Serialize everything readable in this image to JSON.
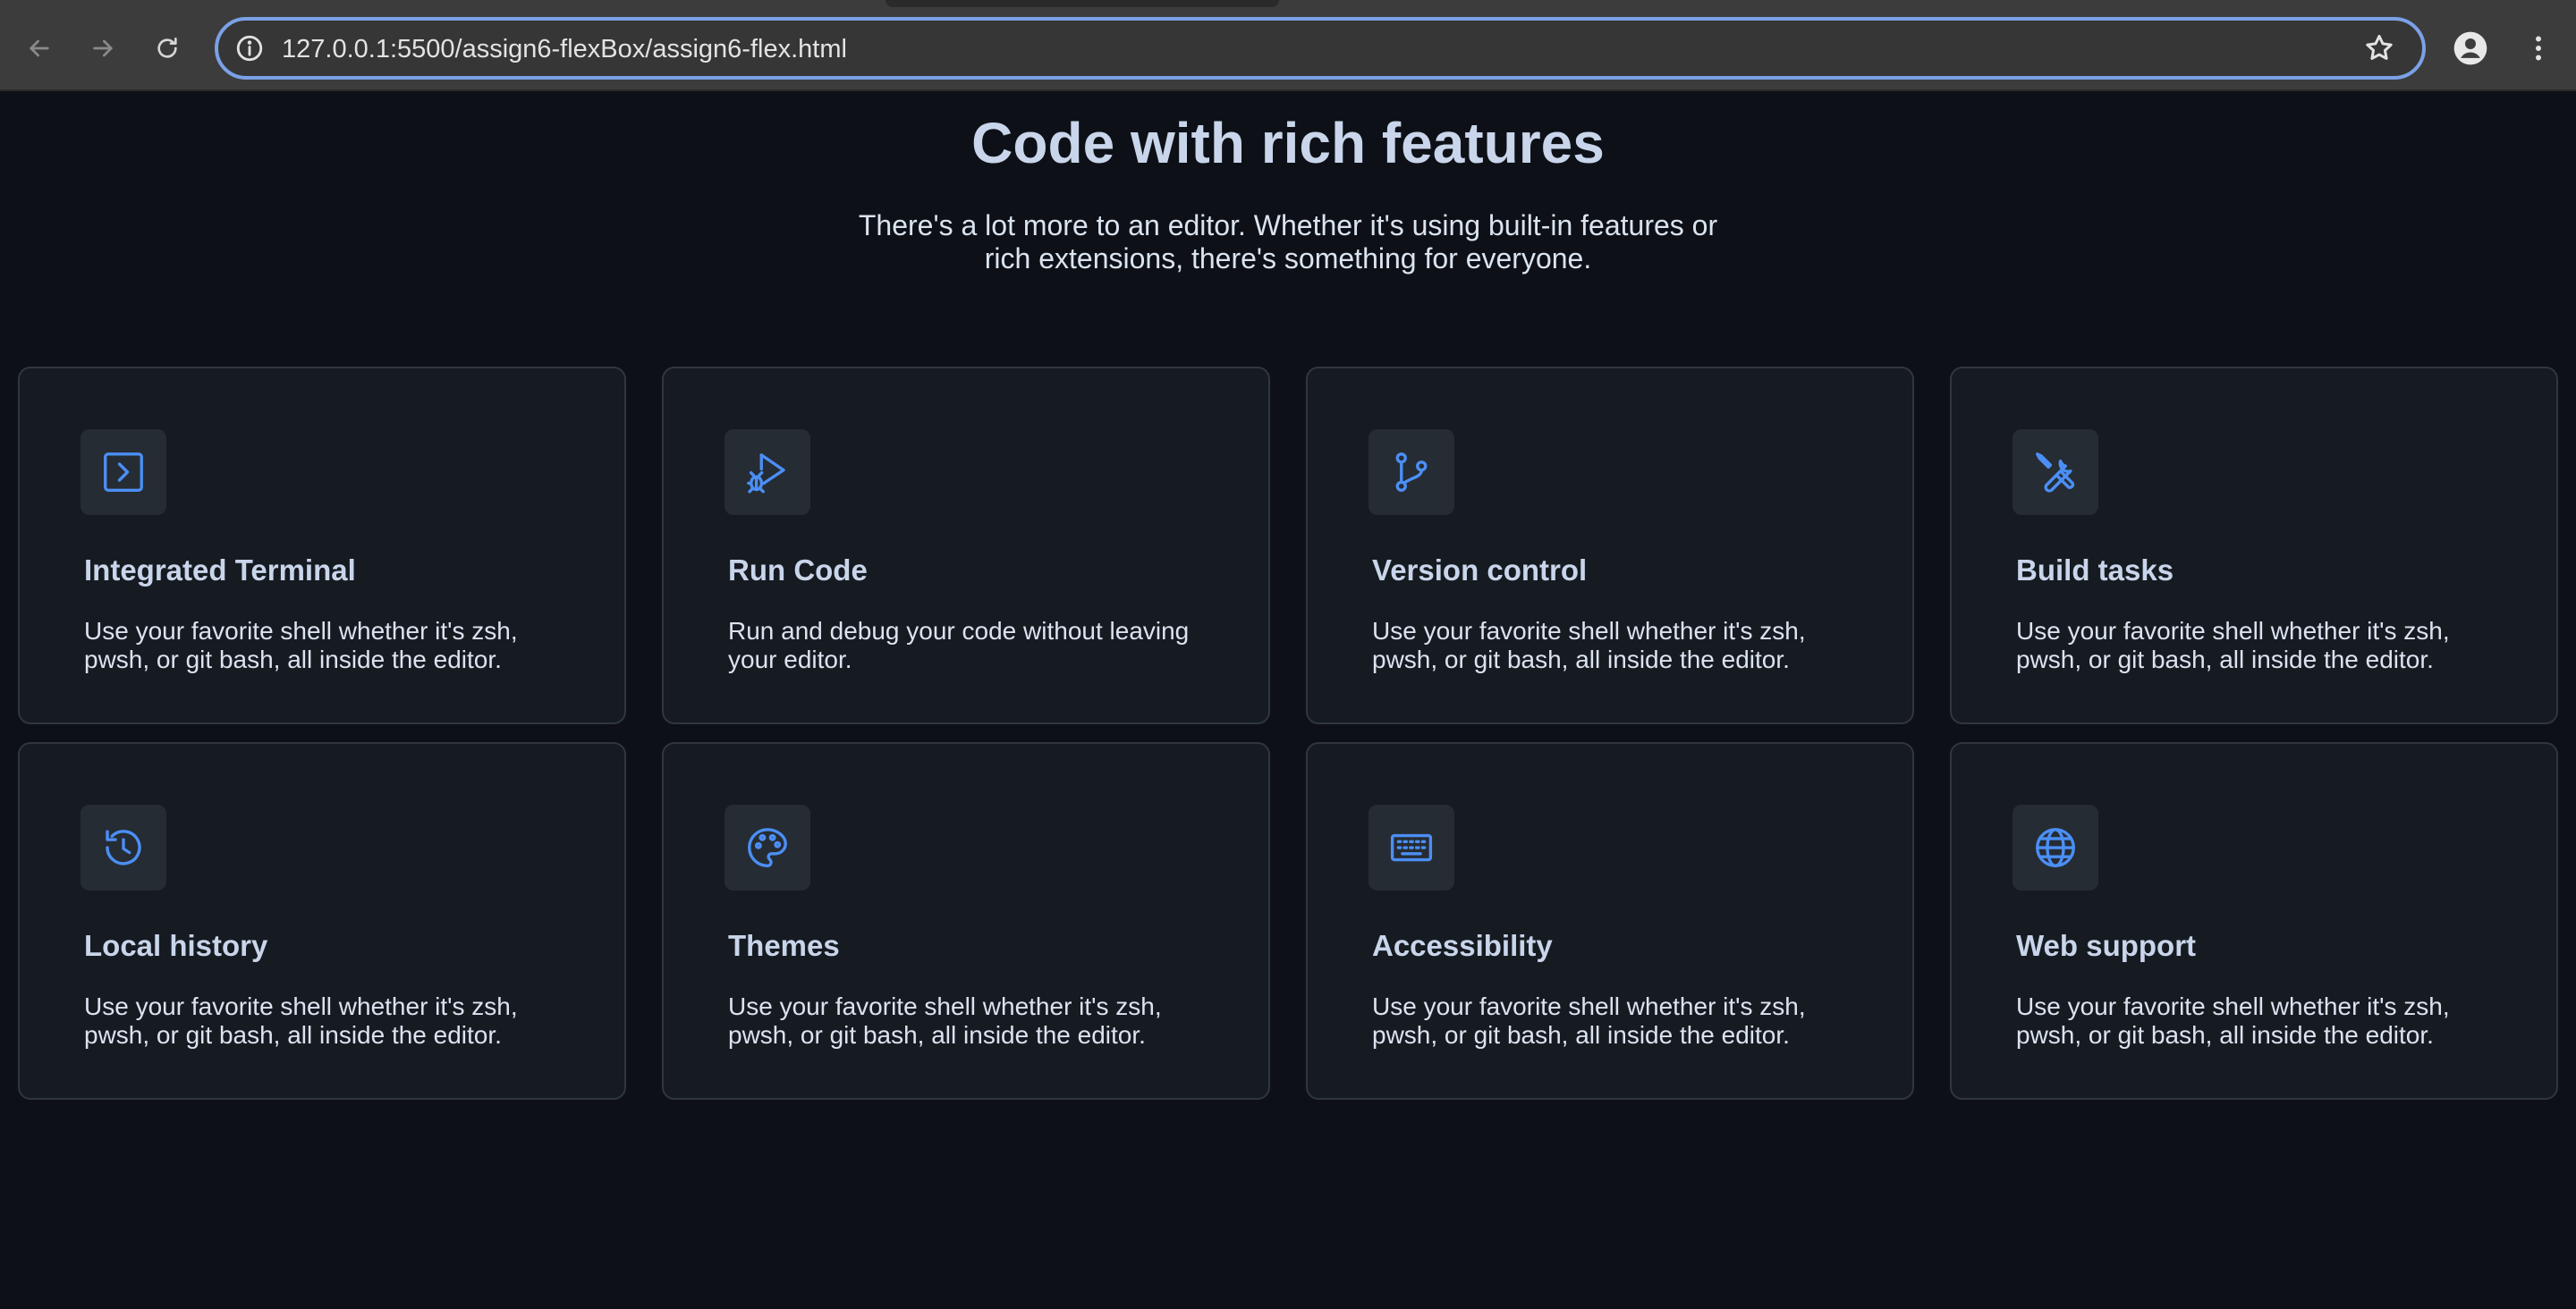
{
  "browser": {
    "url": "127.0.0.1:5500/assign6-flexBox/assign6-flex.html",
    "icons": {
      "back": "back-arrow-icon",
      "forward": "forward-arrow-icon",
      "reload": "reload-icon",
      "site_info": "info-icon",
      "bookmark": "star-icon",
      "profile": "profile-icon",
      "menu": "more-vert-icon"
    }
  },
  "hero": {
    "title": "Code with rich features",
    "subtitle": "There's a lot more to an editor. Whether it's using built-in features or rich extensions, there's something for everyone."
  },
  "colors": {
    "background": "#0d1117",
    "card": "#161b22",
    "card_border": "#30363d",
    "icon_accent": "#4b8ff5",
    "title_text": "#c9d5ea"
  },
  "features": [
    {
      "title": "Integrated Terminal",
      "description": "Use your favorite shell whether it's zsh, pwsh, or git bash, all inside the editor.",
      "icon": "terminal-icon"
    },
    {
      "title": "Run Code",
      "description": "Run and debug your code without leaving your editor.",
      "icon": "run-debug-icon"
    },
    {
      "title": "Version control",
      "description": "Use your favorite shell whether it's zsh, pwsh, or git bash, all inside the editor.",
      "icon": "git-branch-icon"
    },
    {
      "title": "Build tasks",
      "description": "Use your favorite shell whether it's zsh, pwsh, or git bash, all inside the editor.",
      "icon": "tools-icon"
    },
    {
      "title": "Local history",
      "description": "Use your favorite shell whether it's zsh, pwsh, or git bash, all inside the editor.",
      "icon": "history-icon"
    },
    {
      "title": "Themes",
      "description": "Use your favorite shell whether it's zsh, pwsh, or git bash, all inside the editor.",
      "icon": "palette-icon"
    },
    {
      "title": "Accessibility",
      "description": "Use your favorite shell whether it's zsh, pwsh, or git bash, all inside the editor.",
      "icon": "keyboard-icon"
    },
    {
      "title": "Web support",
      "description": "Use your favorite shell whether it's zsh, pwsh, or git bash, all inside the editor.",
      "icon": "globe-icon"
    }
  ]
}
